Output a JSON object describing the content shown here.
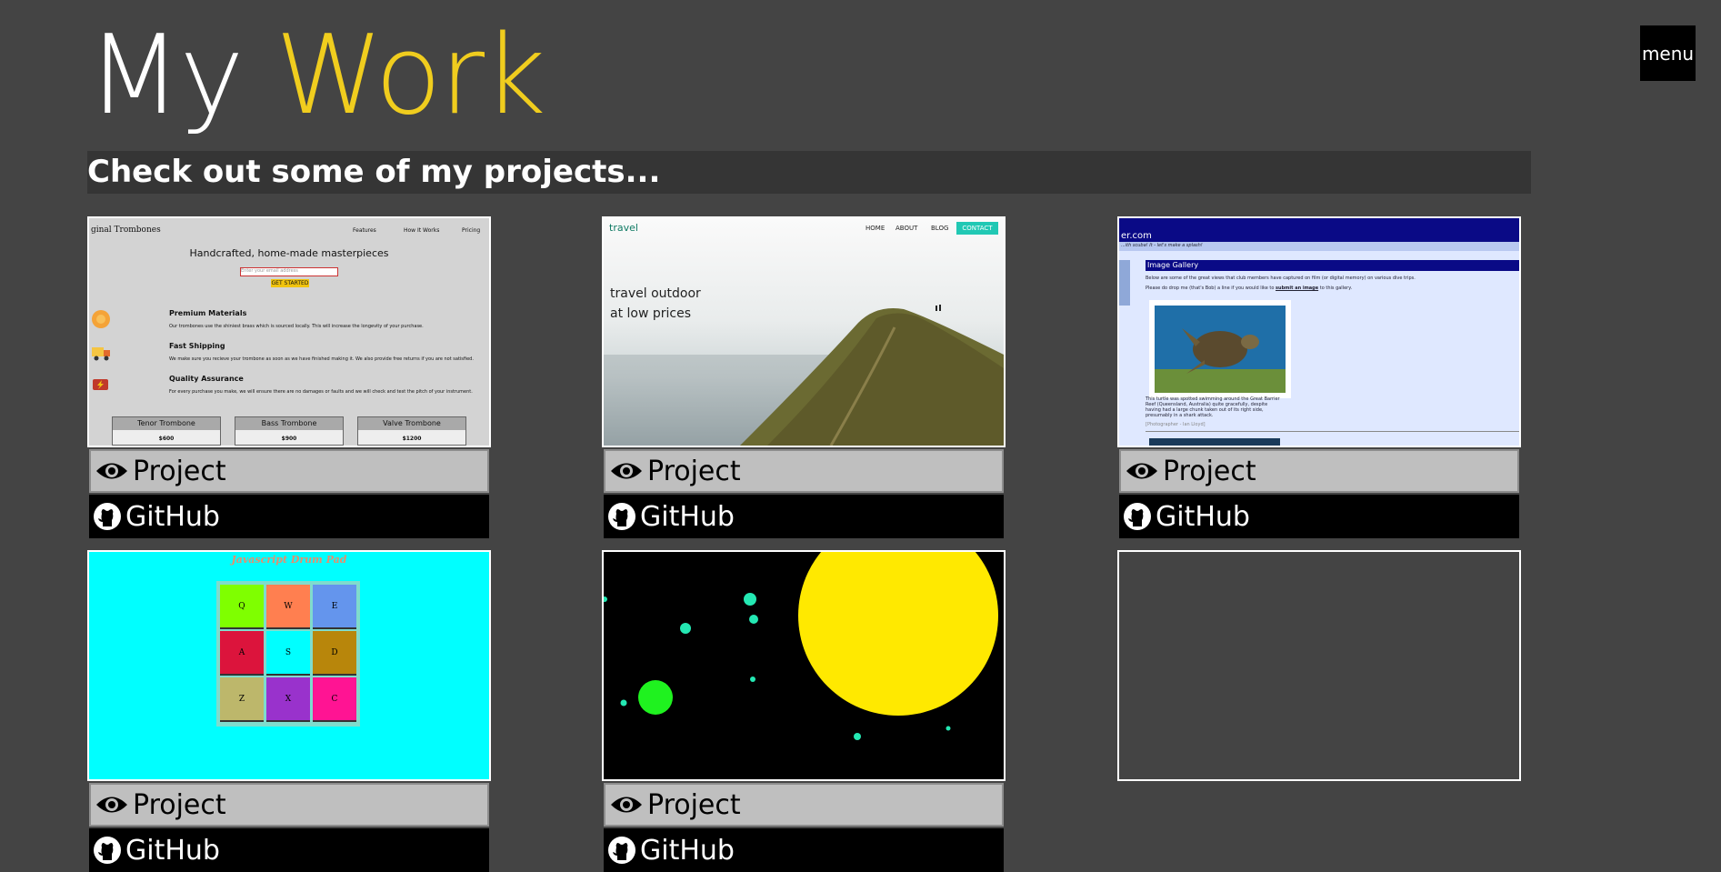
{
  "header": {
    "title_part1": "My",
    "title_part2": "Work",
    "menu_label": "menu",
    "subtitle": "Check out some of my projects..."
  },
  "colors": {
    "background": "#444444",
    "accent": "#f0cd1e",
    "project_button": "#bfbfbf",
    "github_button": "#000000"
  },
  "buttons": {
    "project_label": "Project",
    "github_label": "GitHub"
  },
  "projects": [
    {
      "preview": {
        "brand": "ginal Trombones",
        "nav": [
          "Features",
          "How It Works",
          "Pricing"
        ],
        "heading": "Handcrafted, home-made masterpieces",
        "email_placeholder": "Enter your email address",
        "cta": "GET STARTED",
        "features": [
          {
            "title": "Premium Materials",
            "text": "Our trombones use the shiniest brass which is sourced locally. This will increase the longevity of your purchase."
          },
          {
            "title": "Fast Shipping",
            "text": "We make sure you recieve your trombone as soon as we have finished making it. We also provide free returns if you are not satisfied."
          },
          {
            "title": "Quality Assurance",
            "text": "For every purchase you make, we will ensure there are no damages or faults and we will check and test the pitch of your instrument."
          }
        ],
        "prices": [
          {
            "name": "Tenor Trombone",
            "price": "$600"
          },
          {
            "name": "Bass Trombone",
            "price": "$900"
          },
          {
            "name": "Valve Trombone",
            "price": "$1200"
          }
        ]
      }
    },
    {
      "preview": {
        "logo": "travel",
        "nav": [
          "HOME",
          "ABOUT",
          "BLOG"
        ],
        "contact": "CONTACT",
        "hero_line1": "travel outdoor",
        "hero_line2": "at low prices"
      }
    },
    {
      "preview": {
        "site": "er.com",
        "tagline": "...ith scuba! It - let's make a splash!",
        "gallery_title": "Image Gallery",
        "intro": "Below are some of the great views that club members have captured on film (or digital memory) on various dive trips.",
        "submit_line_prefix": "Please do drop me (that's Bob) a line if you would like to",
        "submit_link": "submit an image",
        "submit_line_suffix": "to this gallery.",
        "caption": "This turtle was spotted swimming around the Great Barrier Reef (Queensland, Australia) quite gracefully, despite having had a large chunk taken out of its right side, presumably in a shark attack.",
        "credit": "[Photographer - Ian Lloyd]"
      }
    },
    {
      "preview": {
        "title": "Javascript Drum Pad",
        "keys": [
          "Q",
          "W",
          "E",
          "A",
          "S",
          "D",
          "Z",
          "X",
          "C"
        ],
        "key_colors": [
          "#7fff00",
          "#ff7f50",
          "#6495ed",
          "#dc143c",
          "#00ffff",
          "#b8860b",
          "#bdb76b",
          "#9932cc",
          "#ff1493"
        ]
      }
    },
    {
      "preview": {
        "scene": "space"
      }
    },
    {
      "preview": {
        "empty": true
      }
    }
  ]
}
